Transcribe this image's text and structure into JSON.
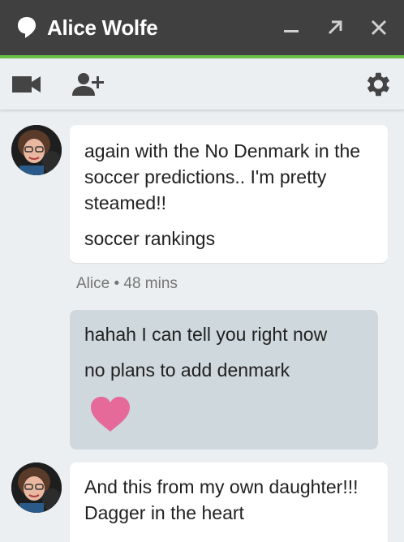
{
  "window": {
    "title": "Alice Wolfe",
    "icon": "speech-bubble-icon",
    "controls": [
      "minimize-icon",
      "popout-icon",
      "close-icon"
    ]
  },
  "toolbar": {
    "icons": [
      "video-call-icon",
      "add-person-icon",
      "gear-icon"
    ]
  },
  "messages": [
    {
      "direction": "incoming",
      "sender": "Alice",
      "lines": [
        "again with the No Denmark in the soccer predictions.. I'm pretty steamed!!",
        "soccer rankings"
      ],
      "meta": "Alice • 48 mins"
    },
    {
      "direction": "outgoing",
      "lines": [
        "hahah I can tell you right now",
        "no plans to add denmark"
      ],
      "sticker": "heart-icon"
    },
    {
      "direction": "incoming",
      "sender": "Alice",
      "lines": [
        "And this from my own daughter!!! Dagger in the heart"
      ]
    }
  ],
  "colors": {
    "titlebar": "#404040",
    "accent": "#6abf45",
    "background": "#eceff1",
    "incoming_bubble": "#ffffff",
    "outgoing_bubble": "#cfd8dc",
    "heart": "#e56a9a"
  }
}
